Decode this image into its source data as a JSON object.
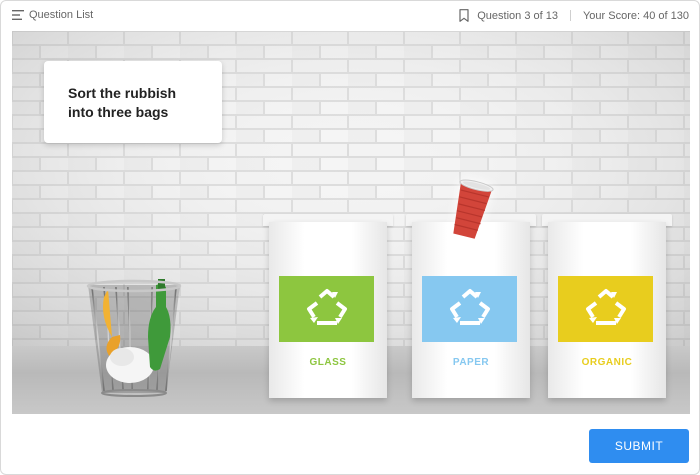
{
  "header": {
    "question_list_label": "Question List",
    "question_progress": "Question 3 of 13",
    "score": "Your Score: 40 of 130"
  },
  "instruction": {
    "line1": "Sort the rubbish",
    "line2": "into three bags"
  },
  "bins": [
    {
      "label": "GLASS",
      "color": "#8dc63f",
      "icon": "recycle-icon"
    },
    {
      "label": "PAPER",
      "color": "#86c8f0",
      "icon": "recycle-icon"
    },
    {
      "label": "ORGANIC",
      "color": "#e8cd1e",
      "icon": "recycle-icon"
    }
  ],
  "draggable_item": {
    "icon": "paper-cup"
  },
  "trash_can": {
    "icon": "wire-trash-can"
  },
  "footer": {
    "submit_label": "SUBMIT",
    "submit_color": "#2f8df0"
  }
}
